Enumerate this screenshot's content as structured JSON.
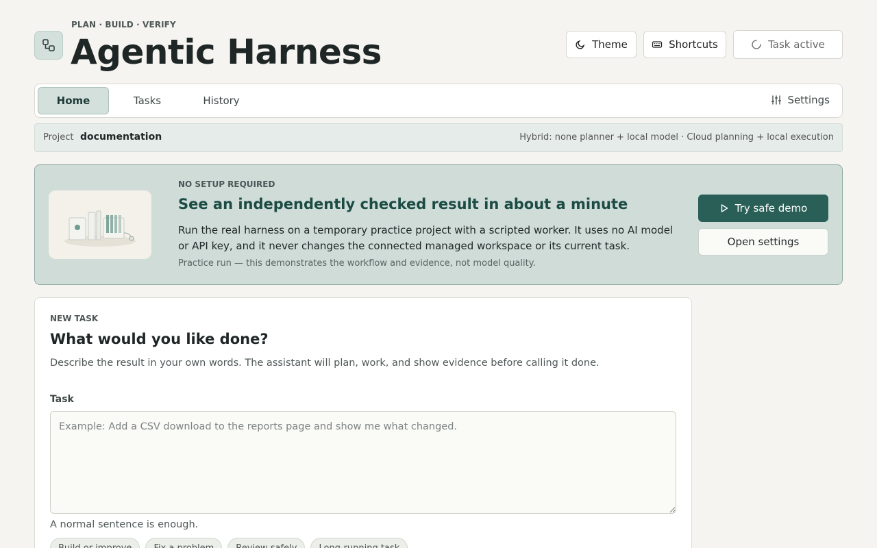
{
  "header": {
    "eyebrow": "PLAN · BUILD · VERIFY",
    "title": "Agentic Harness",
    "buttons": {
      "theme": "Theme",
      "shortcuts": "Shortcuts",
      "task_active": "Task active"
    }
  },
  "nav": {
    "tabs": [
      {
        "label": "Home",
        "active": true
      },
      {
        "label": "Tasks",
        "active": false
      },
      {
        "label": "History",
        "active": false
      }
    ],
    "settings": "Settings"
  },
  "project": {
    "label": "Project",
    "name": "documentation",
    "mode": "Hybrid: none planner + local model · Cloud planning + local execution"
  },
  "demo": {
    "eyebrow": "NO SETUP REQUIRED",
    "title": "See an independently checked result in about a minute",
    "body": "Run the real harness on a temporary practice project with a scripted worker. It uses no AI model or API key, and it never changes the connected managed workspace or its current task.",
    "note": "Practice run — this demonstrates the workflow and evidence, not model quality.",
    "primary_button": "Try safe demo",
    "secondary_button": "Open settings"
  },
  "new_task": {
    "eyebrow": "NEW TASK",
    "title": "What would you like done?",
    "description": "Describe the result in your own words. The assistant will plan, work, and show evidence before calling it done.",
    "field_label": "Task",
    "placeholder": "Example: Add a CSV download to the reports page and show me what changed.",
    "value": "",
    "help": "A normal sentence is enough.",
    "chips": [
      "Build or improve",
      "Fix a problem",
      "Review safely",
      "Long-running task"
    ]
  },
  "colors": {
    "accent": "#2a5f57",
    "banner_bg": "#cfdcd8",
    "page_bg": "#f5f4f0"
  }
}
